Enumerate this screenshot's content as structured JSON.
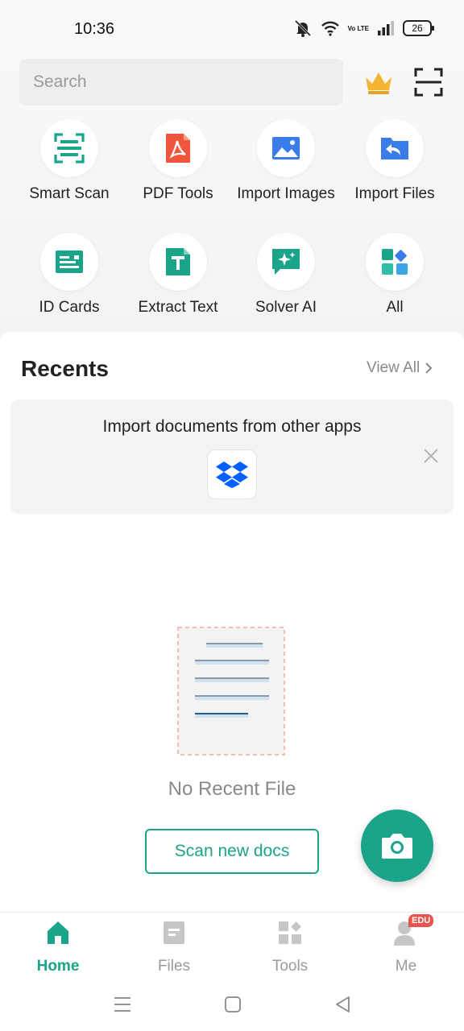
{
  "status_bar": {
    "time": "10:36",
    "network_label": "Vo LTE",
    "battery": "26"
  },
  "search": {
    "placeholder": "Search"
  },
  "tools": [
    {
      "label": "Smart Scan",
      "icon": "smart-scan-icon"
    },
    {
      "label": "PDF Tools",
      "icon": "pdf-icon"
    },
    {
      "label": "Import Images",
      "icon": "image-icon"
    },
    {
      "label": "Import Files",
      "icon": "import-file-icon"
    },
    {
      "label": "ID Cards",
      "icon": "id-card-icon"
    },
    {
      "label": "Extract Text",
      "icon": "text-icon"
    },
    {
      "label": "Solver AI",
      "icon": "ai-chat-icon"
    },
    {
      "label": "All",
      "icon": "grid-icon"
    }
  ],
  "recents": {
    "title": "Recents",
    "view_all": "View All",
    "import_card": {
      "text": "Import documents from other apps",
      "app_icon": "dropbox-icon"
    },
    "empty_text": "No Recent File",
    "scan_button": "Scan new docs"
  },
  "bottom_nav": [
    {
      "label": "Home",
      "active": true
    },
    {
      "label": "Files",
      "active": false
    },
    {
      "label": "Tools",
      "active": false
    },
    {
      "label": "Me",
      "active": false,
      "badge": "EDU"
    }
  ],
  "colors": {
    "accent": "#1aa58a",
    "pdf_red": "#f0563c",
    "blue": "#3a7ce8",
    "badge": "#e8544e"
  }
}
